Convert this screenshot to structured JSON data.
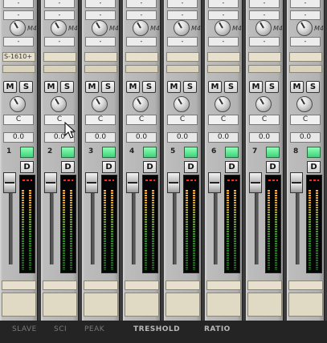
{
  "channels": [
    {
      "number": "1",
      "insert": "S-1610+",
      "pan": "C",
      "volume": "0.0",
      "mute_label": "M",
      "solo_label": "S",
      "disk_label": "D",
      "send_label": "-",
      "m4_label": "M4"
    },
    {
      "number": "2",
      "insert": "",
      "pan": "C",
      "volume": "0.0",
      "mute_label": "M",
      "solo_label": "S",
      "disk_label": "D",
      "send_label": "-",
      "m4_label": "M4"
    },
    {
      "number": "3",
      "insert": "",
      "pan": "C",
      "volume": "0.0",
      "mute_label": "M",
      "solo_label": "S",
      "disk_label": "D",
      "send_label": "-",
      "m4_label": "M4"
    },
    {
      "number": "4",
      "insert": "",
      "pan": "C",
      "volume": "0.0",
      "mute_label": "M",
      "solo_label": "S",
      "disk_label": "D",
      "send_label": "-",
      "m4_label": "M4"
    },
    {
      "number": "5",
      "insert": "",
      "pan": "C",
      "volume": "0.0",
      "mute_label": "M",
      "solo_label": "S",
      "disk_label": "D",
      "send_label": "-",
      "m4_label": "M4"
    },
    {
      "number": "6",
      "insert": "",
      "pan": "C",
      "volume": "0.0",
      "mute_label": "M",
      "solo_label": "S",
      "disk_label": "D",
      "send_label": "-",
      "m4_label": "M4"
    },
    {
      "number": "7",
      "insert": "",
      "pan": "C",
      "volume": "0.0",
      "mute_label": "M",
      "solo_label": "S",
      "disk_label": "D",
      "send_label": "-",
      "m4_label": "M4"
    },
    {
      "number": "8",
      "insert": "",
      "pan": "C",
      "volume": "0.0",
      "mute_label": "M",
      "solo_label": "S",
      "disk_label": "D",
      "send_label": "-",
      "m4_label": "M4"
    }
  ],
  "meter_peak_label": "--",
  "bottom_labels": [
    "SLAVE",
    "SCI",
    "PEAK",
    "TRESHOLD",
    "RATIO"
  ],
  "colors": {
    "record_arm": "#3ed37a",
    "peak": "#ff2a2a",
    "strip": "#b2b2b2"
  },
  "icons": {
    "cursor": "arrow-cursor-icon"
  }
}
